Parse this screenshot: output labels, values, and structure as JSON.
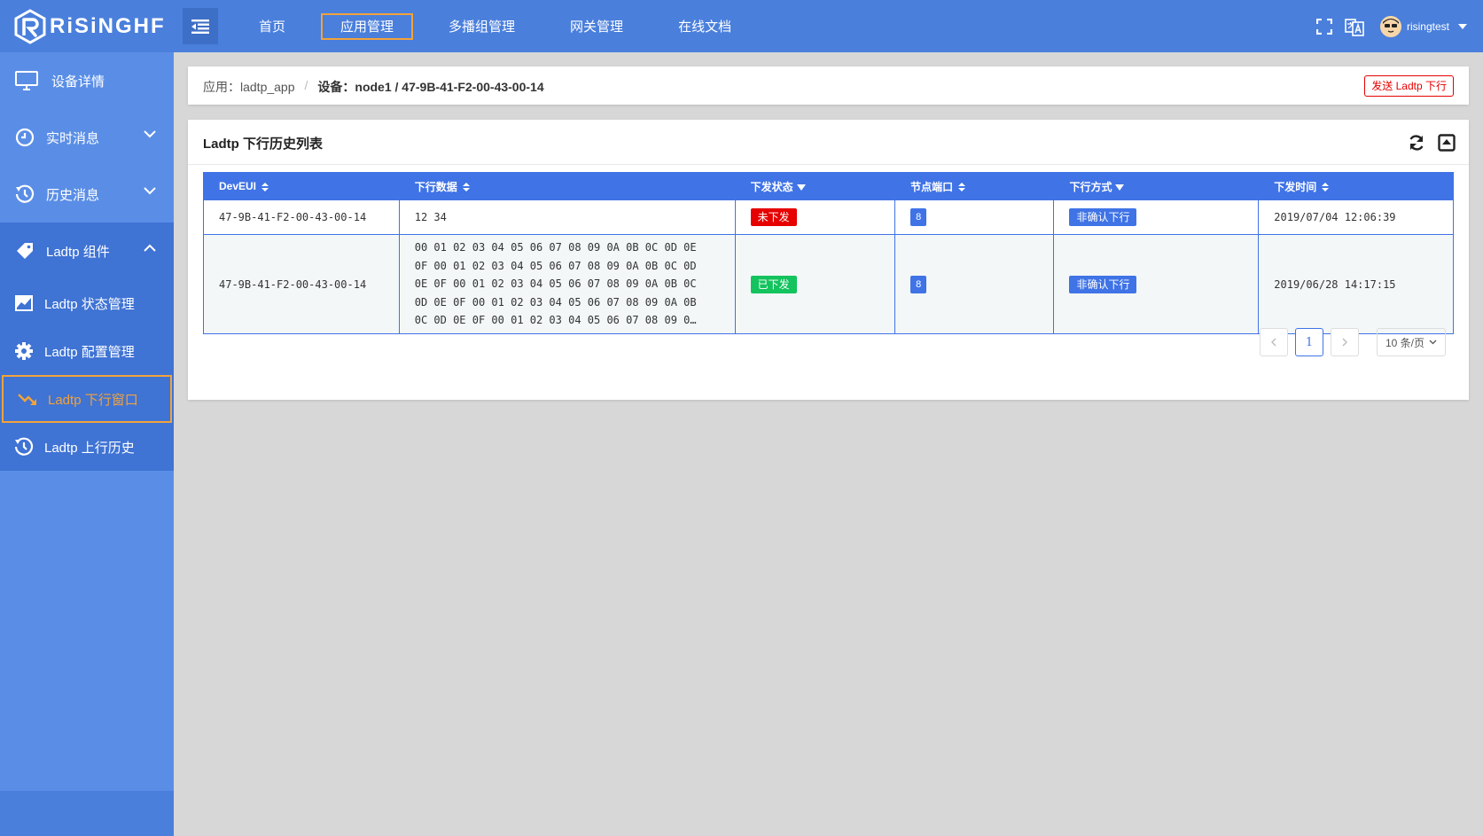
{
  "header": {
    "logo_text": "RiSiNGHF",
    "nav": [
      "首页",
      "应用管理",
      "多播组管理",
      "网关管理",
      "在线文档"
    ],
    "active_nav": 1,
    "username": "risingtest"
  },
  "sidebar": {
    "device_detail": "设备详情",
    "realtime": "实时消息",
    "history": "历史消息",
    "ladtp_group": "Ladtp 组件",
    "sub_items": [
      "Ladtp 状态管理",
      "Ladtp 配置管理",
      "Ladtp 下行窗口",
      "Ladtp 上行历史"
    ],
    "active_sub": 2
  },
  "breadcrumb": {
    "app_label": "应用：ladtp_app",
    "device_label": "设备：node1 / 47-9B-41-F2-00-43-00-14"
  },
  "send_button": "发送 Ladtp 下行",
  "list": {
    "title": "Ladtp 下行历史列表",
    "columns": [
      "DevEUI",
      "下行数据",
      "下发状态",
      "节点端口",
      "下行方式",
      "下发时间"
    ],
    "rows": [
      {
        "deveui": "47-9B-41-F2-00-43-00-14",
        "data_lines": [
          "12 34"
        ],
        "status": "未下发",
        "status_color": "#e60000",
        "port": "8",
        "mode": "非确认下行",
        "time": "2019/07/04 12:06:39"
      },
      {
        "deveui": "47-9B-41-F2-00-43-00-14",
        "data_lines": [
          "00 01 02 03 04 05 06 07 08 09 0A 0B 0C 0D 0E",
          "0F 00 01 02 03 04 05 06 07 08 09 0A 0B 0C 0D",
          "0E 0F 00 01 02 03 04 05 06 07 08 09 0A 0B 0C",
          "0D 0E 0F 00 01 02 03 04 05 06 07 08 09 0A 0B",
          "0C 0D 0E 0F 00 01 02 03 04 05 06 07 08 09 0…"
        ],
        "status": "已下发",
        "status_color": "#13c35e",
        "port": "8",
        "mode": "非确认下行",
        "time": "2019/06/28 14:17:15"
      }
    ]
  },
  "pagination": {
    "current": "1",
    "page_size": "10 条/页"
  },
  "colors": {
    "primary": "#4a7fdc",
    "accent": "#f2a33a",
    "table_head": "#3f73e6"
  }
}
